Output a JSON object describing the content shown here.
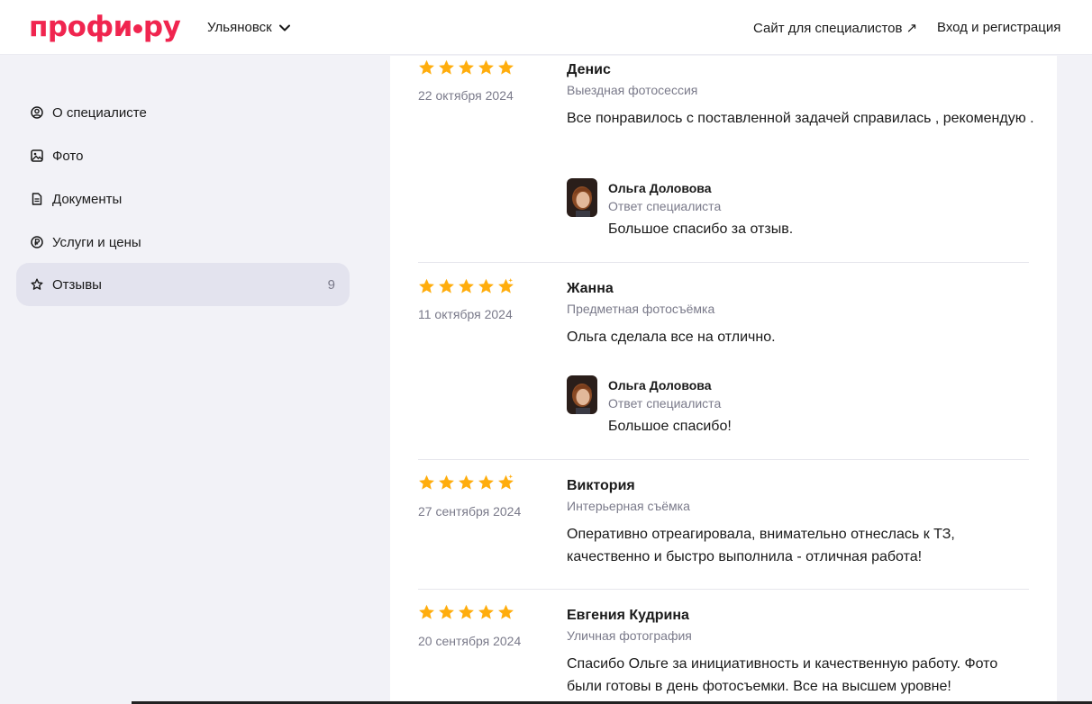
{
  "header": {
    "logo": "профи.ру",
    "logo_left": "профи",
    "logo_right": "ру",
    "city": "Ульяновск",
    "specialists_link": "Сайт для специалистов ↗",
    "login_link": "Вход и регистрация"
  },
  "sidebar": {
    "items": [
      {
        "label": "О специалисте",
        "icon": "person-circle-icon"
      },
      {
        "label": "Фото",
        "icon": "image-icon"
      },
      {
        "label": "Документы",
        "icon": "document-icon"
      },
      {
        "label": "Услуги и цены",
        "icon": "ruble-icon"
      },
      {
        "label": "Отзывы",
        "icon": "star-icon",
        "count": "9",
        "active": true
      }
    ]
  },
  "reviews": [
    {
      "rating": 5,
      "date": "22 октября 2024",
      "author": "Денис",
      "service": "Выездная фотосессия",
      "text": "Все понравилось с поставленной задачей справилась , рекомендую .",
      "reply": {
        "name": "Ольга Доловова",
        "role": "Ответ специалиста",
        "text": "Большое спасибо за отзыв."
      }
    },
    {
      "rating": 4.5,
      "date": "11 октября 2024",
      "author": "Жанна",
      "service": "Предметная фотосъёмка",
      "text": "Ольга сделала все на отлично.",
      "reply": {
        "name": "Ольга Доловова",
        "role": "Ответ специалиста",
        "text": "Большое спасибо!"
      }
    },
    {
      "rating": 4.5,
      "date": "27 сентября 2024",
      "author": "Виктория",
      "service": "Интерьерная съёмка",
      "text": "Оперативно отреагировала, внимательно отнеслась к ТЗ, качественно и быстро выполнила - отличная работа!"
    },
    {
      "rating": 5,
      "date": "20 сентября 2024",
      "author": "Евгения Кудрина",
      "service": "Уличная фотография",
      "text": "Спасибо Ольге за инициативность и качественную работу. Фото были готовы в день фотосъемки. Все на высшем уровне!"
    }
  ],
  "colors": {
    "brand": "#f0254f",
    "star": "#ffad0d",
    "active_nav": "#e3e3ee"
  }
}
